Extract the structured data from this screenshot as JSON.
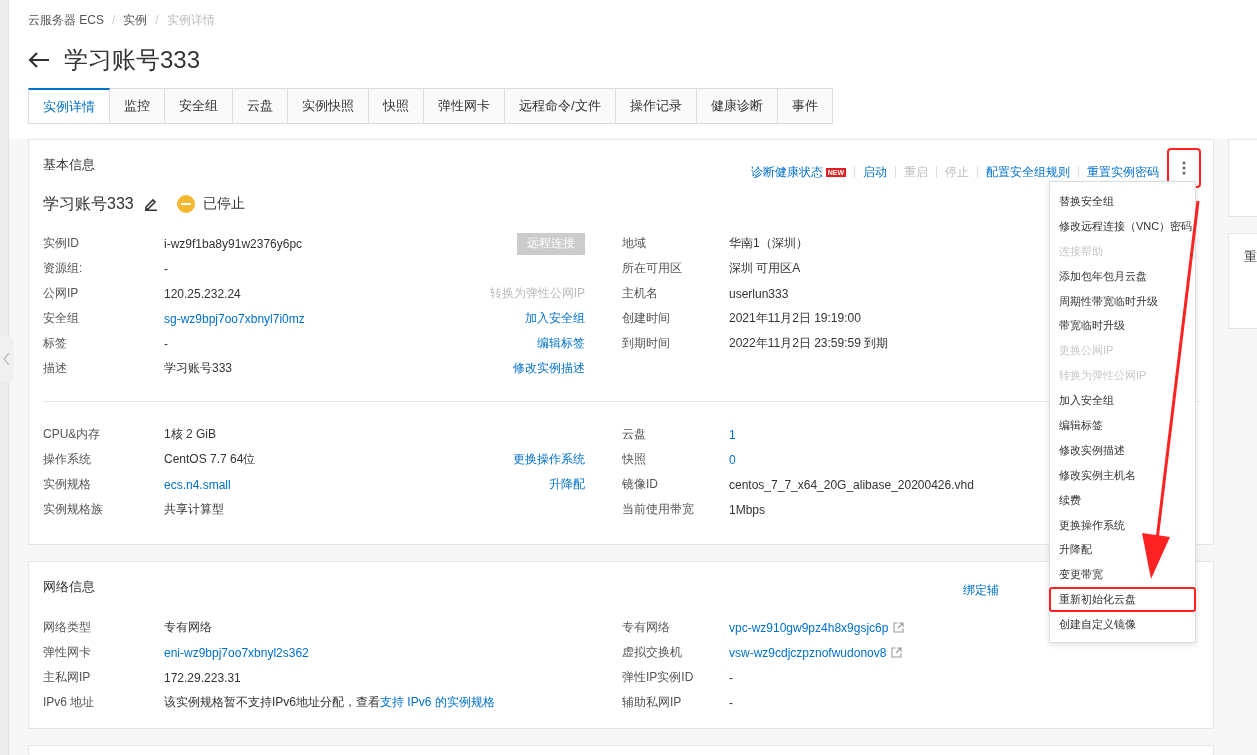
{
  "breadcrumb": {
    "separator": "/",
    "items": [
      {
        "label": "云服务器 ECS",
        "current": false
      },
      {
        "label": "实例",
        "current": false
      },
      {
        "label": "实例详情",
        "current": true
      }
    ]
  },
  "title": "学习账号333",
  "tabs": [
    {
      "label": "实例详情",
      "selected": true
    },
    {
      "label": "监控",
      "selected": false
    },
    {
      "label": "安全组",
      "selected": false
    },
    {
      "label": "云盘",
      "selected": false
    },
    {
      "label": "实例快照",
      "selected": false
    },
    {
      "label": "快照",
      "selected": false
    },
    {
      "label": "弹性网卡",
      "selected": false
    },
    {
      "label": "远程命令/文件",
      "selected": false
    },
    {
      "label": "操作记录",
      "selected": false
    },
    {
      "label": "健康诊断",
      "selected": false
    },
    {
      "label": "事件",
      "selected": false
    }
  ],
  "basic_info": {
    "title": "基本信息",
    "actions": [
      {
        "label": "诊断健康状态",
        "badge": "NEW",
        "disabled": false
      },
      {
        "label": "启动",
        "disabled": false
      },
      {
        "label": "重启",
        "disabled": true
      },
      {
        "label": "停止",
        "disabled": true
      },
      {
        "label": "配置安全组规则",
        "disabled": false
      },
      {
        "label": "重置实例密码",
        "disabled": false
      }
    ],
    "more_annotated": true,
    "name": "学习账号333",
    "status": {
      "label": "已停止"
    },
    "sections": [
      {
        "left": [
          {
            "label": "实例ID",
            "value": "i-wz9f1ba8y91w2376y6pc",
            "link": false,
            "action": {
              "label": "远程连接",
              "kind": "button",
              "disabled": true
            }
          },
          {
            "label": "资源组:",
            "value": "-",
            "link": false
          },
          {
            "label": "公网IP",
            "value": "120.25.232.24",
            "link": false,
            "action": {
              "label": "转换为弹性公网IP",
              "kind": "link",
              "disabled": true
            }
          },
          {
            "label": "安全组",
            "value": "sg-wz9bpj7oo7xbnyl7i0mz",
            "link": true,
            "action": {
              "label": "加入安全组",
              "kind": "link",
              "disabled": false
            }
          },
          {
            "label": "标签",
            "value": "-",
            "link": false,
            "action": {
              "label": "编辑标签",
              "kind": "link",
              "disabled": false
            }
          },
          {
            "label": "描述",
            "value": "学习账号333",
            "link": false,
            "action": {
              "label": "修改实例描述",
              "kind": "link",
              "disabled": false
            }
          }
        ],
        "right": [
          {
            "label": "地域",
            "value": "华南1（深圳）",
            "link": false
          },
          {
            "label": "所在可用区",
            "value": "深圳 可用区A",
            "link": false
          },
          {
            "label": "主机名",
            "value": "userlun333",
            "link": false
          },
          {
            "label": "创建时间",
            "value": "2021年11月2日 19:19:00",
            "link": false
          },
          {
            "label": "到期时间",
            "value": "2022年11月2日 23:59:59 到期",
            "link": false
          }
        ]
      },
      {
        "left": [
          {
            "label": "CPU&内存",
            "value": "1核 2 GiB",
            "link": false
          },
          {
            "label": "操作系统",
            "value": "CentOS 7.7 64位",
            "link": false,
            "action": {
              "label": "更换操作系统",
              "kind": "link",
              "disabled": false
            }
          },
          {
            "label": "实例规格",
            "value": "ecs.n4.small",
            "link": true,
            "action": {
              "label": "升降配",
              "kind": "link",
              "disabled": false
            }
          },
          {
            "label": "实例规格族",
            "value": "共享计算型",
            "link": false
          }
        ],
        "right": [
          {
            "label": "云盘",
            "value": "1",
            "link": true
          },
          {
            "label": "快照",
            "value": "0",
            "link": true
          },
          {
            "label": "镜像ID",
            "value": "centos_7_7_x64_20G_alibase_20200426.vhd",
            "link": false
          },
          {
            "label": "当前使用带宽",
            "value": "1Mbps",
            "link": false
          }
        ]
      }
    ]
  },
  "menu": {
    "arrow": true,
    "items": [
      {
        "label": "替换安全组",
        "disabled": false,
        "highlighted": false
      },
      {
        "label": "修改远程连接（VNC）密码",
        "disabled": false,
        "highlighted": false
      },
      {
        "label": "连接帮助",
        "disabled": true,
        "highlighted": false
      },
      {
        "label": "添加包年包月云盘",
        "disabled": false,
        "highlighted": false
      },
      {
        "label": "周期性带宽临时升级",
        "disabled": false,
        "highlighted": false
      },
      {
        "label": "带宽临时升级",
        "disabled": false,
        "highlighted": false
      },
      {
        "label": "更换公网IP",
        "disabled": true,
        "highlighted": false
      },
      {
        "label": "转换为弹性公网IP",
        "disabled": true,
        "highlighted": false
      },
      {
        "label": "加入安全组",
        "disabled": false,
        "highlighted": false
      },
      {
        "label": "编辑标签",
        "disabled": false,
        "highlighted": false
      },
      {
        "label": "修改实例描述",
        "disabled": false,
        "highlighted": false
      },
      {
        "label": "修改实例主机名",
        "disabled": false,
        "highlighted": false
      },
      {
        "label": "续费",
        "disabled": false,
        "highlighted": false
      },
      {
        "label": "更换操作系统",
        "disabled": false,
        "highlighted": false
      },
      {
        "label": "升降配",
        "disabled": false,
        "highlighted": false
      },
      {
        "label": "变更带宽",
        "disabled": false,
        "highlighted": false
      },
      {
        "label": "重新初始化云盘",
        "disabled": false,
        "highlighted": true
      },
      {
        "label": "创建自定义镜像",
        "disabled": false,
        "highlighted": false
      }
    ]
  },
  "network_info": {
    "title": "网络信息",
    "action": "绑定辅",
    "left": [
      {
        "label": "网络类型",
        "value": "专有网络",
        "link": false
      },
      {
        "label": "弹性网卡",
        "value": "eni-wz9bpj7oo7xbnyl2s362",
        "link": true
      },
      {
        "label": "主私网IP",
        "value": "172.29.223.31",
        "link": false
      },
      {
        "label": "IPv6 地址",
        "value": "该实例规格暂不支持IPv6地址分配，查看",
        "suffix_link": "支持 IPv6 的实例规格"
      }
    ],
    "right": [
      {
        "label": "专有网络",
        "value": "vpc-wz910gw9pz4h8x9gsjc6p",
        "link": true,
        "external": true
      },
      {
        "label": "虚拟交换机",
        "value": "vsw-wz9cdjczpznofwudonov8",
        "link": true,
        "external": true
      },
      {
        "label": "弹性IP实例ID",
        "value": "-",
        "link": false
      },
      {
        "label": "辅助私网IP",
        "value": "-",
        "link": false
      }
    ]
  },
  "side_panel": {
    "text": "重"
  }
}
